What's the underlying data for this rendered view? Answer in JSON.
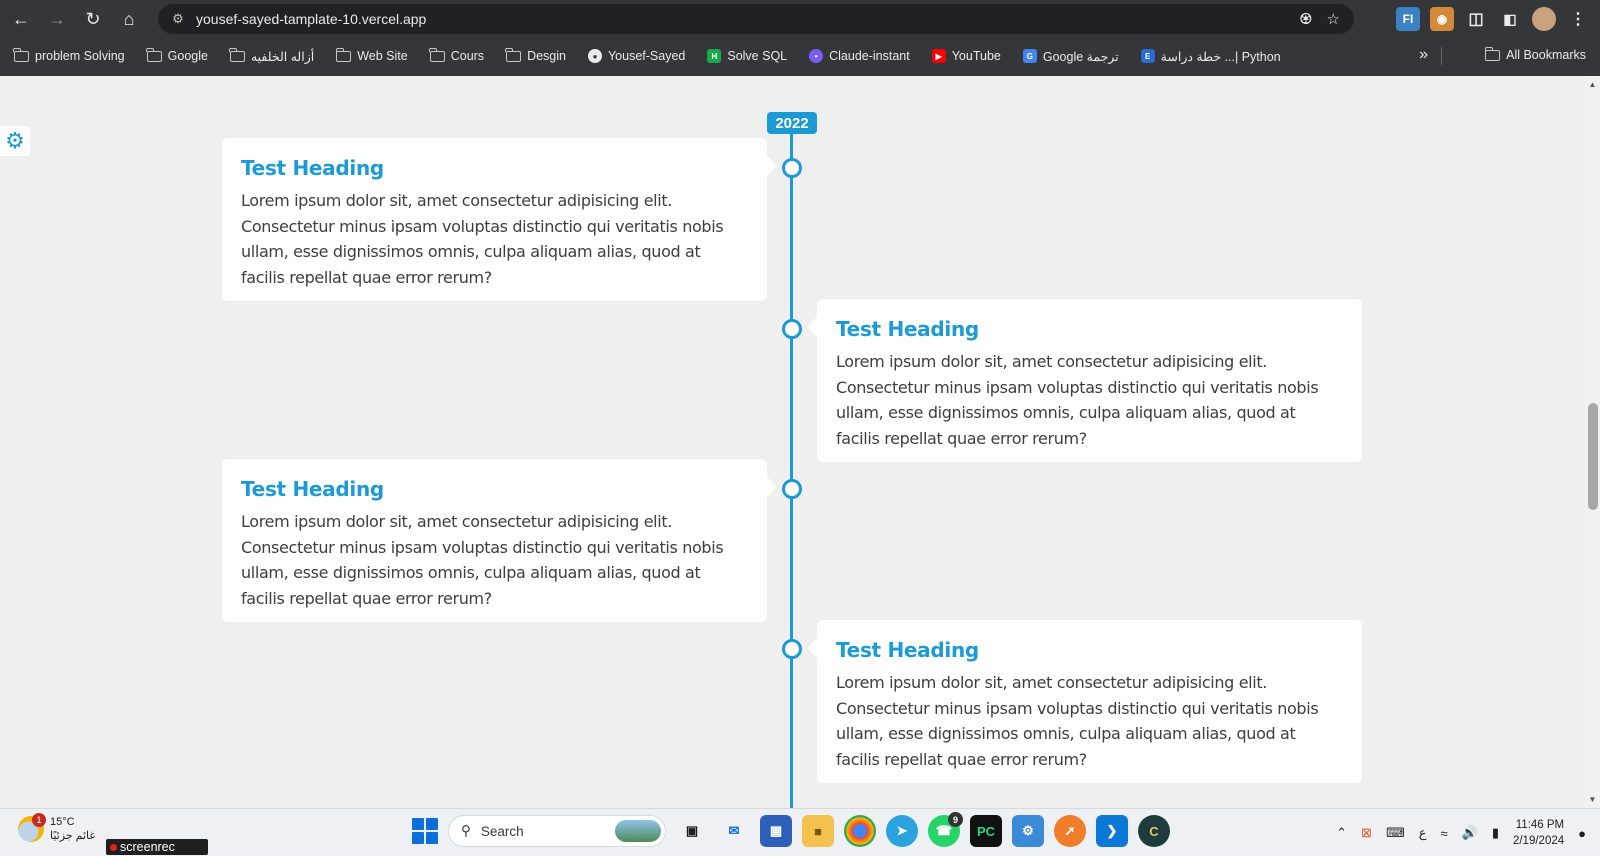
{
  "browser": {
    "url": "yousef-sayed-tamplate-10.vercel.app",
    "bookmarks": [
      {
        "label": "problem Solving",
        "icon": "folder-icon"
      },
      {
        "label": "Google",
        "icon": "folder-icon"
      },
      {
        "label": "أزاله الخلفيه",
        "icon": "folder-icon"
      },
      {
        "label": "Web Site",
        "icon": "folder-icon"
      },
      {
        "label": "Cours",
        "icon": "folder-icon"
      },
      {
        "label": "Desgin",
        "icon": "folder-icon"
      },
      {
        "label": "Yousef-Sayed",
        "icon": "globe-icon"
      },
      {
        "label": "Solve SQL",
        "icon": "hackerrank-icon"
      },
      {
        "label": "Claude-instant",
        "icon": "poe-icon"
      },
      {
        "label": "YouTube",
        "icon": "youtube-icon"
      },
      {
        "label": "Google ترجمة",
        "icon": "google-translate-icon"
      },
      {
        "label": "خطة دراسة ...| Python",
        "icon": "e-icon"
      }
    ],
    "all_bookmarks_label": "All Bookmarks"
  },
  "timeline": {
    "year": "2022",
    "accent_color": "#1b9ad6",
    "items": [
      {
        "heading": "Test Heading",
        "text": "Lorem ipsum dolor sit, amet consectetur adipisicing elit. Consectetur minus ipsam voluptas distinctio qui veritatis nobis ullam, esse dignissimos omnis, culpa aliquam alias, quod at facilis repellat quae error rerum?",
        "side": "left"
      },
      {
        "heading": "Test Heading",
        "text": "Lorem ipsum dolor sit, amet consectetur adipisicing elit. Consectetur minus ipsam voluptas distinctio qui veritatis nobis ullam, esse dignissimos omnis, culpa aliquam alias, quod at facilis repellat quae error rerum?",
        "side": "right"
      },
      {
        "heading": "Test Heading",
        "text": "Lorem ipsum dolor sit, amet consectetur adipisicing elit. Consectetur minus ipsam voluptas distinctio qui veritatis nobis ullam, esse dignissimos omnis, culpa aliquam alias, quod at facilis repellat quae error rerum?",
        "side": "left"
      },
      {
        "heading": "Test Heading",
        "text": "Lorem ipsum dolor sit, amet consectetur adipisicing elit. Consectetur minus ipsam voluptas distinctio qui veritatis nobis ullam, esse dignissimos omnis, culpa aliquam alias, quod at facilis repellat quae error rerum?",
        "side": "right"
      }
    ]
  },
  "taskbar": {
    "weather_temp": "15°C",
    "weather_desc": "غائم جزئيًا",
    "weather_badge": "1",
    "screenrec_label": "screenrec",
    "search_placeholder": "Search",
    "whatsapp_badge": "9",
    "keyboard_lang": "ع",
    "time": "11:46 PM",
    "date": "2/19/2024"
  }
}
